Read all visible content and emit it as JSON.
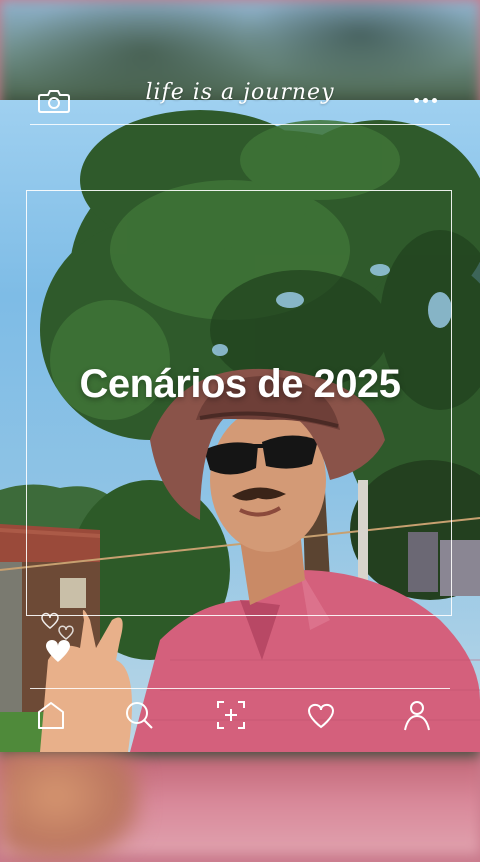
{
  "header": {
    "brand_text": "life is a journey",
    "camera_icon": "camera-icon",
    "more_icon": "more-options-icon"
  },
  "main": {
    "title": "Cenários de 2025"
  },
  "decor": {
    "hearts_icon": "hearts-icon"
  },
  "bottom_nav": {
    "items": [
      {
        "icon": "home-icon"
      },
      {
        "icon": "search-icon"
      },
      {
        "icon": "add-capture-icon"
      },
      {
        "icon": "heart-icon"
      },
      {
        "icon": "profile-icon"
      }
    ]
  },
  "colors": {
    "overlay": "#ffffff",
    "shirt": "#d4607c",
    "sky": "#8ec3e5"
  }
}
